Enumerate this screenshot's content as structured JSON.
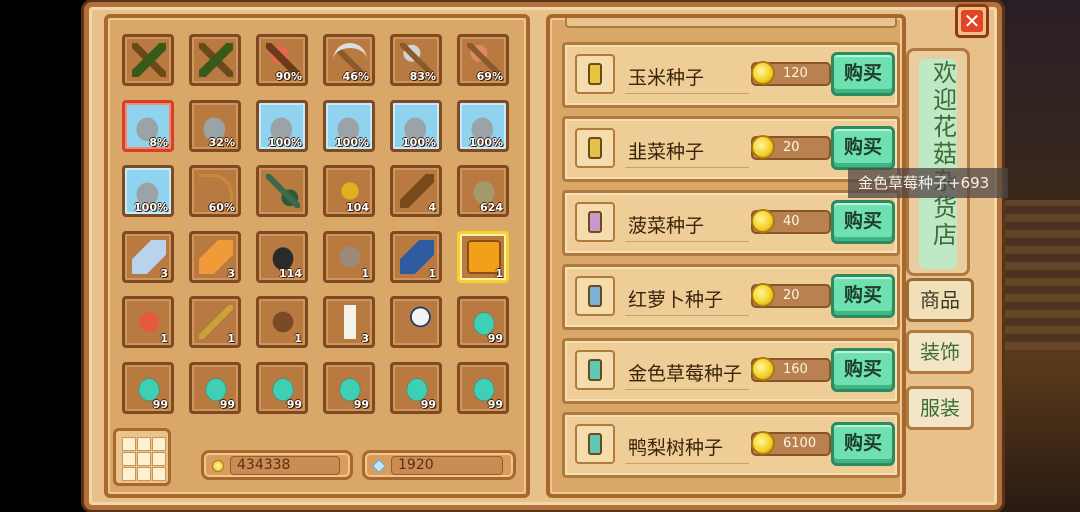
{
  "inventory": {
    "slots": [
      {
        "icon": "pickaxe-icon",
        "count": ""
      },
      {
        "icon": "pickaxe-icon",
        "count": ""
      },
      {
        "icon": "axe-icon",
        "count": "90%"
      },
      {
        "icon": "scythe-icon",
        "count": "46%"
      },
      {
        "icon": "hoe-icon",
        "count": "83%"
      },
      {
        "icon": "hoe-copper-icon",
        "count": "69%"
      },
      {
        "icon": "watering-can-icon",
        "count": "8%"
      },
      {
        "icon": "watering-can-icon",
        "count": "32%"
      },
      {
        "icon": "watering-can-icon",
        "count": "100%"
      },
      {
        "icon": "watering-can-icon",
        "count": "100%"
      },
      {
        "icon": "watering-can-icon",
        "count": "100%"
      },
      {
        "icon": "watering-can-icon",
        "count": "100%"
      },
      {
        "icon": "watering-can-icon",
        "count": "100%"
      },
      {
        "icon": "fishing-rod-icon",
        "count": "60%"
      },
      {
        "icon": "shovel-icon",
        "count": ""
      },
      {
        "icon": "wheat-icon",
        "count": "104"
      },
      {
        "icon": "wood-log-icon",
        "count": "4"
      },
      {
        "icon": "stone-icon",
        "count": "624"
      },
      {
        "icon": "iron-bar-icon",
        "count": "3"
      },
      {
        "icon": "copper-bar-icon",
        "count": "3"
      },
      {
        "icon": "coal-icon",
        "count": "114"
      },
      {
        "icon": "fiber-icon",
        "count": "1"
      },
      {
        "icon": "blue-scroll-icon",
        "count": "1"
      },
      {
        "icon": "seed-packet-orange-icon",
        "count": "1"
      },
      {
        "icon": "shrimp-icon",
        "count": "1"
      },
      {
        "icon": "golden-key-icon",
        "count": "1"
      },
      {
        "icon": "cocoa-pod-icon",
        "count": "1"
      },
      {
        "icon": "milk-bottle-icon",
        "count": "3"
      },
      {
        "icon": "magnifier-icon",
        "count": ""
      },
      {
        "icon": "seed-jar-icon",
        "count": "99"
      },
      {
        "icon": "seed-jar-icon",
        "count": "99"
      },
      {
        "icon": "seed-jar-icon",
        "count": "99"
      },
      {
        "icon": "seed-jar-icon",
        "count": "99"
      },
      {
        "icon": "seed-jar-icon",
        "count": "99"
      },
      {
        "icon": "seed-jar-icon",
        "count": "99"
      },
      {
        "icon": "seed-jar-icon",
        "count": "99"
      }
    ],
    "gold": "434338",
    "diamonds": "1920"
  },
  "shop": {
    "title_chars": [
      "欢",
      "迎",
      "花",
      "菇",
      "杂",
      "货",
      "店"
    ],
    "tabs": {
      "goods": "商品",
      "decor": "装饰",
      "clothing": "服装"
    },
    "items": [
      {
        "name": "玉米种子",
        "price": "120",
        "buy": "购买",
        "icon": "corn-seed-icon",
        "color": "#e7c43a"
      },
      {
        "name": "韭菜种子",
        "price": "20",
        "buy": "购买",
        "icon": "leek-seed-icon",
        "color": "#e2c24a"
      },
      {
        "name": "菠菜种子",
        "price": "40",
        "buy": "购买",
        "icon": "spinach-seed-icon",
        "color": "#c997c9"
      },
      {
        "name": "红萝卜种子",
        "price": "20",
        "buy": "购买",
        "icon": "carrot-seed-icon",
        "color": "#7ab2d8"
      },
      {
        "name": "金色草莓种子",
        "price": "160",
        "buy": "购买",
        "icon": "golden-strawberry-seed-icon",
        "color": "#5fc9b5"
      },
      {
        "name": "鸭梨树种子",
        "price": "6100",
        "buy": "购买",
        "icon": "pear-tree-seed-icon",
        "color": "#5fc9b5"
      }
    ]
  },
  "toast": "金色草莓种子+693",
  "close_label": "✕"
}
